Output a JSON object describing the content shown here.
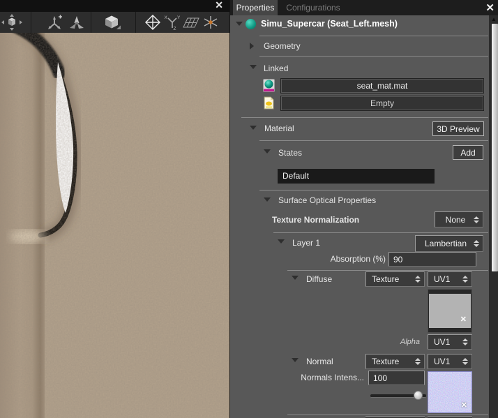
{
  "icons": {
    "close": "✕",
    "remove": "✕",
    "scroll_up": "▲"
  },
  "colors": {
    "accent_teal": "#14a68e",
    "leather": "#b3a28c",
    "normal_map_blue": "#8585e8",
    "panel_bg": "#585858"
  },
  "viewport": {
    "toolbar_icons": [
      "move-tool",
      "axis-tripod-add",
      "axis-tripod-solid",
      "orientation-cube",
      "octahedron-gizmo",
      "xyz-axes",
      "ground-grid",
      "axes-star"
    ]
  },
  "panel": {
    "tabs": [
      {
        "label": "Properties"
      },
      {
        "label": "Configurations"
      }
    ],
    "root_label": "Simu_Supercar (Seat_Left.mesh)",
    "geometry": {
      "label": "Geometry"
    },
    "linked": {
      "label": "Linked",
      "material_file": "seat_mat.mat",
      "texture_file": "Empty"
    },
    "material": {
      "label": "Material",
      "preview_button": "3D Preview",
      "states": {
        "label": "States",
        "add_button": "Add",
        "selected": "Default"
      },
      "surface": {
        "label": "Surface Optical Properties",
        "texture_normalization_label": "Texture Normalization",
        "texture_normalization_value": "None",
        "layer": {
          "label": "Layer 1",
          "model": "Lambertian",
          "absorption_label": "Absorption (%)",
          "absorption_value": "90",
          "diffuse": {
            "label": "Diffuse",
            "source": "Texture",
            "uv": "UV1",
            "alpha_label": "Alpha",
            "alpha_uv": "UV1"
          },
          "normal": {
            "label": "Normal",
            "source": "Texture",
            "uv": "UV1",
            "intensity_label": "Normals Intens...",
            "intensity_value": "100"
          }
        }
      }
    }
  }
}
